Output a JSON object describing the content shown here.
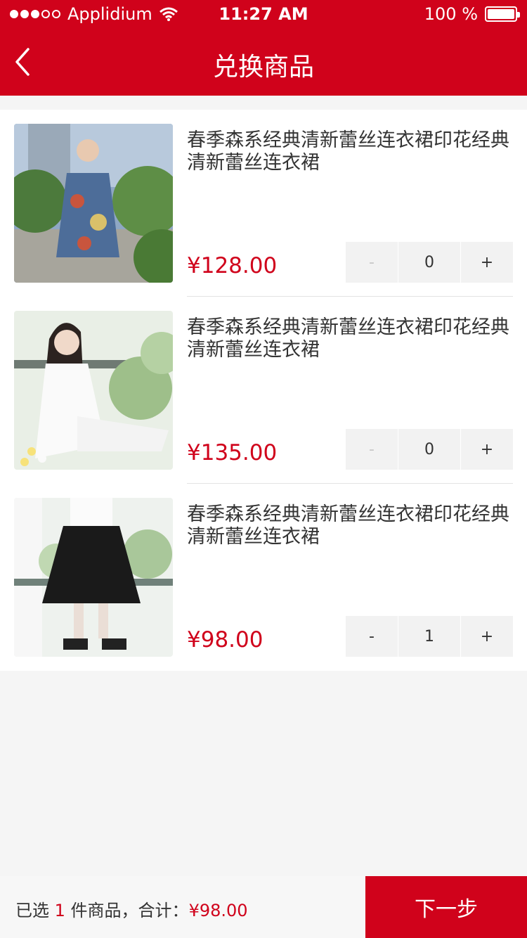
{
  "status": {
    "carrier": "Applidium",
    "time": "11:27 AM",
    "battery": "100 %"
  },
  "nav": {
    "title": "兑换商品"
  },
  "products": [
    {
      "name": "春季森系经典清新蕾丝连衣裙印花经典清新蕾丝连衣裙",
      "price": "¥128.00",
      "qty": "0",
      "minus": "-",
      "plus": "+",
      "image": "floral-denim-dress-photo"
    },
    {
      "name": "春季森系经典清新蕾丝连衣裙印花经典清新蕾丝连衣裙",
      "price": "¥135.00",
      "qty": "0",
      "minus": "-",
      "plus": "+",
      "image": "white-lace-dress-photo"
    },
    {
      "name": "春季森系经典清新蕾丝连衣裙印花经典清新蕾丝连衣裙",
      "price": "¥98.00",
      "qty": "1",
      "minus": "-",
      "plus": "+",
      "image": "black-tulle-skirt-photo"
    }
  ],
  "footer": {
    "prefix": "已选 ",
    "count": "1",
    "middle": " 件商品，合计：",
    "total": "¥98.00",
    "next": "下一步"
  },
  "colors": {
    "accent": "#d0021b",
    "background": "#f5f5f5"
  }
}
